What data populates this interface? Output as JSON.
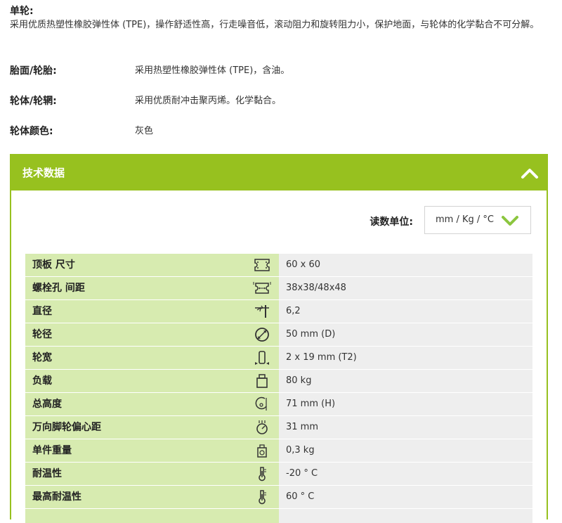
{
  "intro": {
    "title": "单轮:",
    "text": "采用优质热塑性橡胶弹性体 (TPE)，操作舒适性高，行走噪音低，滚动阻力和旋转阻力小，保护地面，与轮体的化学黏合不可分解。"
  },
  "specs": [
    {
      "label": "胎面/轮胎:",
      "value": "采用热塑性橡胶弹性体 (TPE)，含油。"
    },
    {
      "label": "轮体/轮辋:",
      "value": "采用优质耐冲击聚丙烯。化学黏合。"
    },
    {
      "label": "轮体颜色:",
      "value": "灰色"
    }
  ],
  "panel": {
    "title": "技术数据",
    "unit_label": "读数单位:",
    "unit_value": "mm / Kg / °C"
  },
  "colors": {
    "accent": "#97c11f",
    "label_bg": "#d7ebb0",
    "value_bg": "#eeeeee"
  },
  "rows": [
    {
      "name": "顶板 尺寸",
      "icon": "plate-size-icon",
      "value": "60 x 60"
    },
    {
      "name": "螺栓孔 间距",
      "icon": "bolt-hole-spacing-icon",
      "value": "38x38/48x48"
    },
    {
      "name": "直径",
      "icon": "diameter-icon",
      "value": "6,2"
    },
    {
      "name": "轮径",
      "icon": "wheel-diameter-icon",
      "value": "50 mm (D)"
    },
    {
      "name": "轮宽",
      "icon": "wheel-width-icon",
      "value": "2 x 19 mm (T2)"
    },
    {
      "name": "负载",
      "icon": "load-weight-icon",
      "value": "80 kg"
    },
    {
      "name": "总高度",
      "icon": "overall-height-icon",
      "value": "71 mm (H)"
    },
    {
      "name": "万向脚轮偏心距",
      "icon": "swivel-offset-icon",
      "value": "31 mm"
    },
    {
      "name": "单件重量",
      "icon": "unit-weight-icon",
      "value": "0,3 kg"
    },
    {
      "name": "耐温性",
      "icon": "thermometer-icon",
      "value": "-20 ° C"
    },
    {
      "name": "最高耐温性",
      "icon": "thermometer-icon",
      "value": "60 ° C"
    }
  ]
}
